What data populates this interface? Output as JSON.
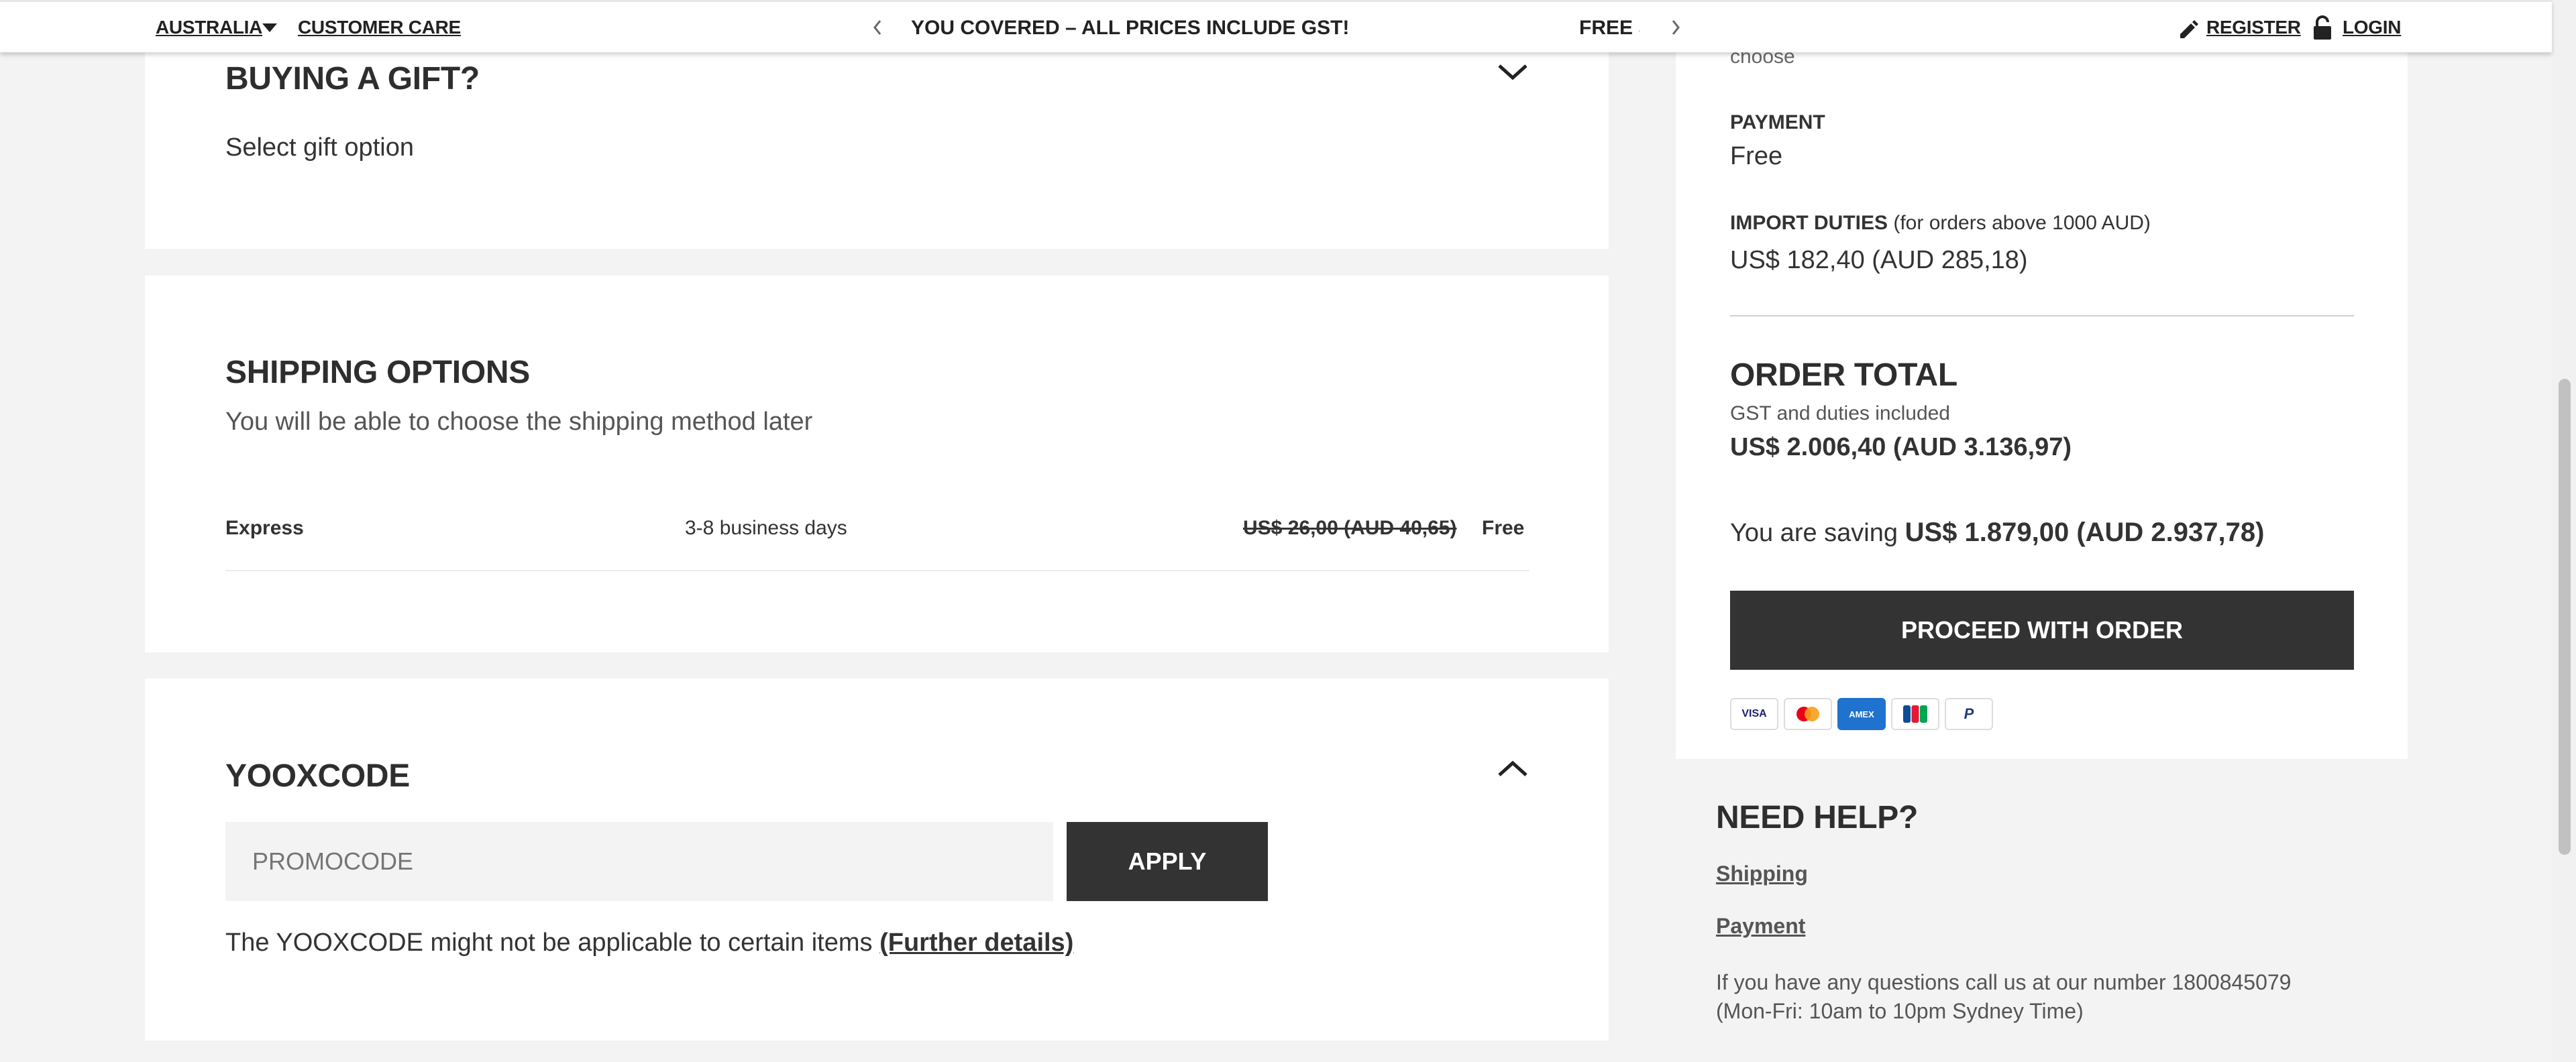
{
  "topbar": {
    "country": "AUSTRALIA",
    "customer_care": "CUSTOMER CARE",
    "promo_message": "YOU COVERED – ALL PRICES INCLUDE GST!",
    "promo_message_next": "FREE S",
    "register": "REGISTER",
    "login": "LOGIN"
  },
  "gift": {
    "title": "BUYING A GIFT?",
    "option": "Select gift option"
  },
  "shipping": {
    "title": "SHIPPING OPTIONS",
    "subtitle": "You will be able to choose the shipping method later",
    "method": "Express",
    "duration": "3-8 business days",
    "old_price": "US$ 26,00 (AUD 40,65)",
    "price": "Free"
  },
  "yooxcode": {
    "title": "YOOXCODE",
    "placeholder": "PROMOCODE",
    "apply": "APPLY",
    "note": "The YOOXCODE might not be applicable to certain items",
    "further_details": "(Further details)"
  },
  "summary": {
    "cut_text": "choose",
    "payment_label": "PAYMENT",
    "payment_value": "Free",
    "import_label": "IMPORT DUTIES",
    "import_note": "(for orders above 1000 AUD)",
    "import_value": "US$ 182,40 (AUD 285,18)",
    "order_total_label": "ORDER TOTAL",
    "order_total_note": "GST and duties included",
    "order_total_value": "US$ 2.006,40 (AUD 3.136,97)",
    "saving_label": "You are saving",
    "saving_value": "US$ 1.879,00 (AUD 2.937,78)",
    "proceed": "PROCEED WITH ORDER",
    "payment_icons": [
      "VISA",
      "mastercard",
      "AMEX",
      "JCB",
      "PayPal"
    ]
  },
  "help": {
    "title": "NEED HELP?",
    "shipping_link": "Shipping",
    "payment_link": "Payment",
    "contact_line1": "If you have any questions call us at our number 1800845079",
    "contact_line2": "(Mon-Fri: 10am to 10pm Sydney Time)"
  },
  "colors": {
    "accent_dark": "#333333",
    "page_background": "#f3f3f3",
    "amex_blue": "#1f72cd"
  }
}
